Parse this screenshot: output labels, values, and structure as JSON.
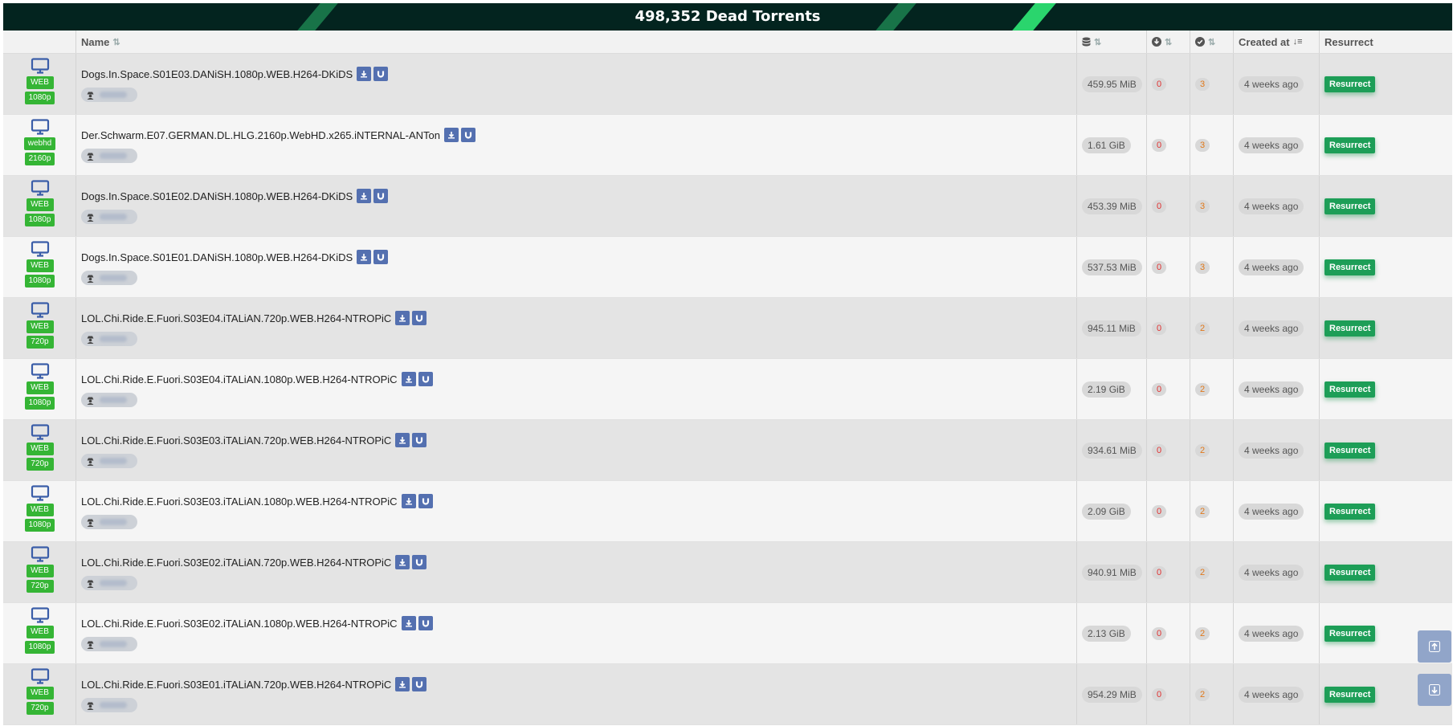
{
  "banner": {
    "title": "498,352 Dead Torrents"
  },
  "table": {
    "headers": {
      "name": "Name",
      "created": "Created at",
      "resurrect": "Resurrect"
    },
    "rows": [
      {
        "type": "WEB",
        "resolution": "1080p",
        "name": "Dogs.In.Space.S01E03.DANiSH.1080p.WEB.H264-DKiDS",
        "size": "459.95 MiB",
        "leechers": "0",
        "seeders": "3",
        "created": "4 weeks ago",
        "action": "Resurrect"
      },
      {
        "type": "webhd",
        "resolution": "2160p",
        "name": "Der.Schwarm.E07.GERMAN.DL.HLG.2160p.WebHD.x265.iNTERNAL-ANTon",
        "size": "1.61 GiB",
        "leechers": "0",
        "seeders": "3",
        "created": "4 weeks ago",
        "action": "Resurrect"
      },
      {
        "type": "WEB",
        "resolution": "1080p",
        "name": "Dogs.In.Space.S01E02.DANiSH.1080p.WEB.H264-DKiDS",
        "size": "453.39 MiB",
        "leechers": "0",
        "seeders": "3",
        "created": "4 weeks ago",
        "action": "Resurrect"
      },
      {
        "type": "WEB",
        "resolution": "1080p",
        "name": "Dogs.In.Space.S01E01.DANiSH.1080p.WEB.H264-DKiDS",
        "size": "537.53 MiB",
        "leechers": "0",
        "seeders": "3",
        "created": "4 weeks ago",
        "action": "Resurrect"
      },
      {
        "type": "WEB",
        "resolution": "720p",
        "name": "LOL.Chi.Ride.E.Fuori.S03E04.iTALiAN.720p.WEB.H264-NTROPiC",
        "size": "945.11 MiB",
        "leechers": "0",
        "seeders": "2",
        "created": "4 weeks ago",
        "action": "Resurrect"
      },
      {
        "type": "WEB",
        "resolution": "1080p",
        "name": "LOL.Chi.Ride.E.Fuori.S03E04.iTALiAN.1080p.WEB.H264-NTROPiC",
        "size": "2.19 GiB",
        "leechers": "0",
        "seeders": "2",
        "created": "4 weeks ago",
        "action": "Resurrect"
      },
      {
        "type": "WEB",
        "resolution": "720p",
        "name": "LOL.Chi.Ride.E.Fuori.S03E03.iTALiAN.720p.WEB.H264-NTROPiC",
        "size": "934.61 MiB",
        "leechers": "0",
        "seeders": "2",
        "created": "4 weeks ago",
        "action": "Resurrect"
      },
      {
        "type": "WEB",
        "resolution": "1080p",
        "name": "LOL.Chi.Ride.E.Fuori.S03E03.iTALiAN.1080p.WEB.H264-NTROPiC",
        "size": "2.09 GiB",
        "leechers": "0",
        "seeders": "2",
        "created": "4 weeks ago",
        "action": "Resurrect"
      },
      {
        "type": "WEB",
        "resolution": "720p",
        "name": "LOL.Chi.Ride.E.Fuori.S03E02.iTALiAN.720p.WEB.H264-NTROPiC",
        "size": "940.91 MiB",
        "leechers": "0",
        "seeders": "2",
        "created": "4 weeks ago",
        "action": "Resurrect"
      },
      {
        "type": "WEB",
        "resolution": "1080p",
        "name": "LOL.Chi.Ride.E.Fuori.S03E02.iTALiAN.1080p.WEB.H264-NTROPiC",
        "size": "2.13 GiB",
        "leechers": "0",
        "seeders": "2",
        "created": "4 weeks ago",
        "action": "Resurrect"
      },
      {
        "type": "WEB",
        "resolution": "720p",
        "name": "LOL.Chi.Ride.E.Fuori.S03E01.iTALiAN.720p.WEB.H264-NTROPiC",
        "size": "954.29 MiB",
        "leechers": "0",
        "seeders": "2",
        "created": "4 weeks ago",
        "action": "Resurrect"
      }
    ]
  },
  "icons": {
    "category": "tv-monitor-icon",
    "download": "download-icon",
    "magnet": "magnet-icon",
    "uploader": "anonymous-user-icon",
    "size_header": "database-icon",
    "leechers_header": "download-circle-icon",
    "seeders_header": "check-circle-icon",
    "scroll_up": "arrow-up-icon",
    "scroll_down": "arrow-down-icon"
  },
  "colors": {
    "banner_bg": "#03241f",
    "accent_green": "#2ad56d",
    "badge_green": "#35b535",
    "resurrect_green": "#1d9e57",
    "action_blue": "#5470b0",
    "scroll_button": "#91a5c9"
  }
}
